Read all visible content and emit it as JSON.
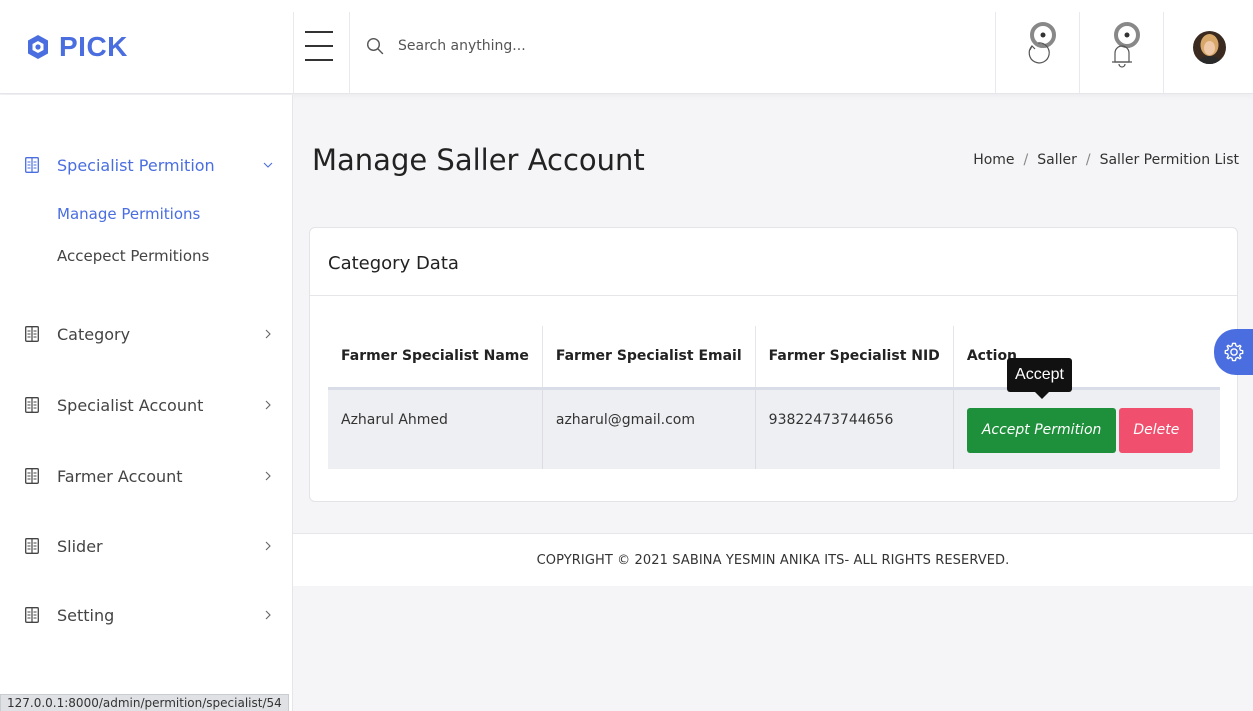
{
  "brand": {
    "name": "PICK",
    "accent": "#4a6ee0"
  },
  "search": {
    "placeholder": "Search anything..."
  },
  "header_icons": [
    "menu-icon",
    "search-icon",
    "sync-icon",
    "bell-icon",
    "avatar"
  ],
  "sidebar": {
    "items": [
      {
        "label": "Specialist Permition",
        "icon": "book-icon",
        "expanded": true,
        "children": [
          {
            "label": "Manage Permitions",
            "active": true
          },
          {
            "label": "Accepect Permitions",
            "active": false
          }
        ]
      },
      {
        "label": "Category",
        "icon": "book-icon",
        "expanded": false
      },
      {
        "label": "Specialist Account",
        "icon": "book-icon",
        "expanded": false
      },
      {
        "label": "Farmer Account",
        "icon": "book-icon",
        "expanded": false
      },
      {
        "label": "Slider",
        "icon": "book-icon",
        "expanded": false
      },
      {
        "label": "Setting",
        "icon": "book-icon",
        "expanded": false
      }
    ]
  },
  "page": {
    "title": "Manage Saller Account",
    "breadcrumb": [
      "Home",
      "Saller",
      "Saller Permition List"
    ]
  },
  "card": {
    "title": "Category Data",
    "columns": [
      "Farmer Specialist Name",
      "Farmer Specialist Email",
      "Farmer Specialist NID",
      "Action"
    ],
    "rows": [
      {
        "name": "Azharul Ahmed",
        "email": "azharul@gmail.com",
        "nid": "93822473744656",
        "accept_label": "Accept Permition",
        "delete_label": "Delete"
      }
    ]
  },
  "tooltip": {
    "text": "Accept"
  },
  "footer": {
    "text": "COPYRIGHT © 2021 SABINA YESMIN ANIKA ITS- ALL RIGHTS RESERVED."
  },
  "statusbar": {
    "url": "127.0.0.1:8000/admin/permition/specialist/54"
  },
  "colors": {
    "accept": "#1e8f3a",
    "delete": "#f0506e",
    "accent": "#4a6ee0"
  }
}
